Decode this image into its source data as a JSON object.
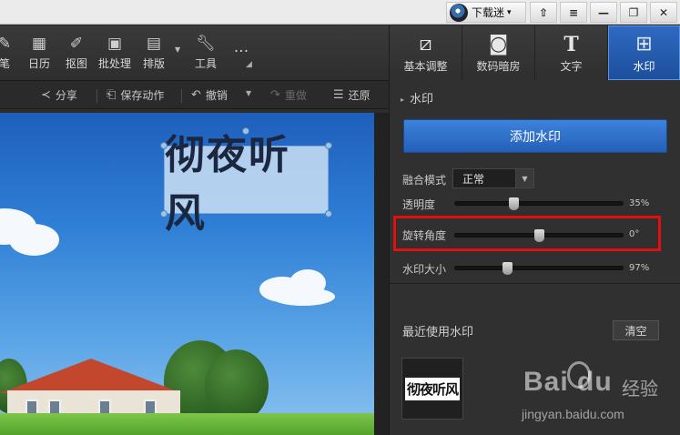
{
  "titlebar": {
    "user_name": "下载迷",
    "caret": "▾"
  },
  "toolbar": {
    "items": [
      {
        "label": "笔",
        "icon": "brush-icon"
      },
      {
        "label": "日历",
        "icon": "calendar-icon"
      },
      {
        "label": "抠图",
        "icon": "pin-icon"
      },
      {
        "label": "批处理",
        "icon": "batch-icon"
      },
      {
        "label": "排版",
        "icon": "layout-icon"
      },
      {
        "label": "工具",
        "icon": "wrench-icon"
      },
      {
        "label": "",
        "icon": "more-icon"
      }
    ]
  },
  "subbar": {
    "share": "分享",
    "save_action": "保存动作",
    "undo": "撤销",
    "redo": "重做",
    "restore": "还原"
  },
  "canvas": {
    "watermark_text": "彻夜听风"
  },
  "right_tabs": [
    {
      "label": "基本调整",
      "icon": "crop-icon",
      "active": false
    },
    {
      "label": "数码暗房",
      "icon": "camera-icon",
      "active": false
    },
    {
      "label": "文字",
      "icon": "text-icon",
      "active": false
    },
    {
      "label": "水印",
      "icon": "watermark-icon",
      "active": true
    }
  ],
  "watermark_panel": {
    "section_title": "水印",
    "add_button": "添加水印",
    "blend_label": "融合模式",
    "blend_value": "正常",
    "opacity_label": "透明度",
    "opacity_value": "35%",
    "opacity_level": 0.35,
    "rotate_label": "旋转角度",
    "rotate_value": "0°",
    "rotate_level": 0.5,
    "size_label": "水印大小",
    "size_value": "97%",
    "size_level": 0.31
  },
  "recent": {
    "title": "最近使用水印",
    "clear_button": "清空",
    "thumb_text": "彻夜听风"
  },
  "baidu": {
    "logo": "Bai du",
    "cn": "经验",
    "url": "jingyan.baidu.com"
  },
  "colors": {
    "accent": "#2a66c0",
    "highlight": "#e01010"
  }
}
